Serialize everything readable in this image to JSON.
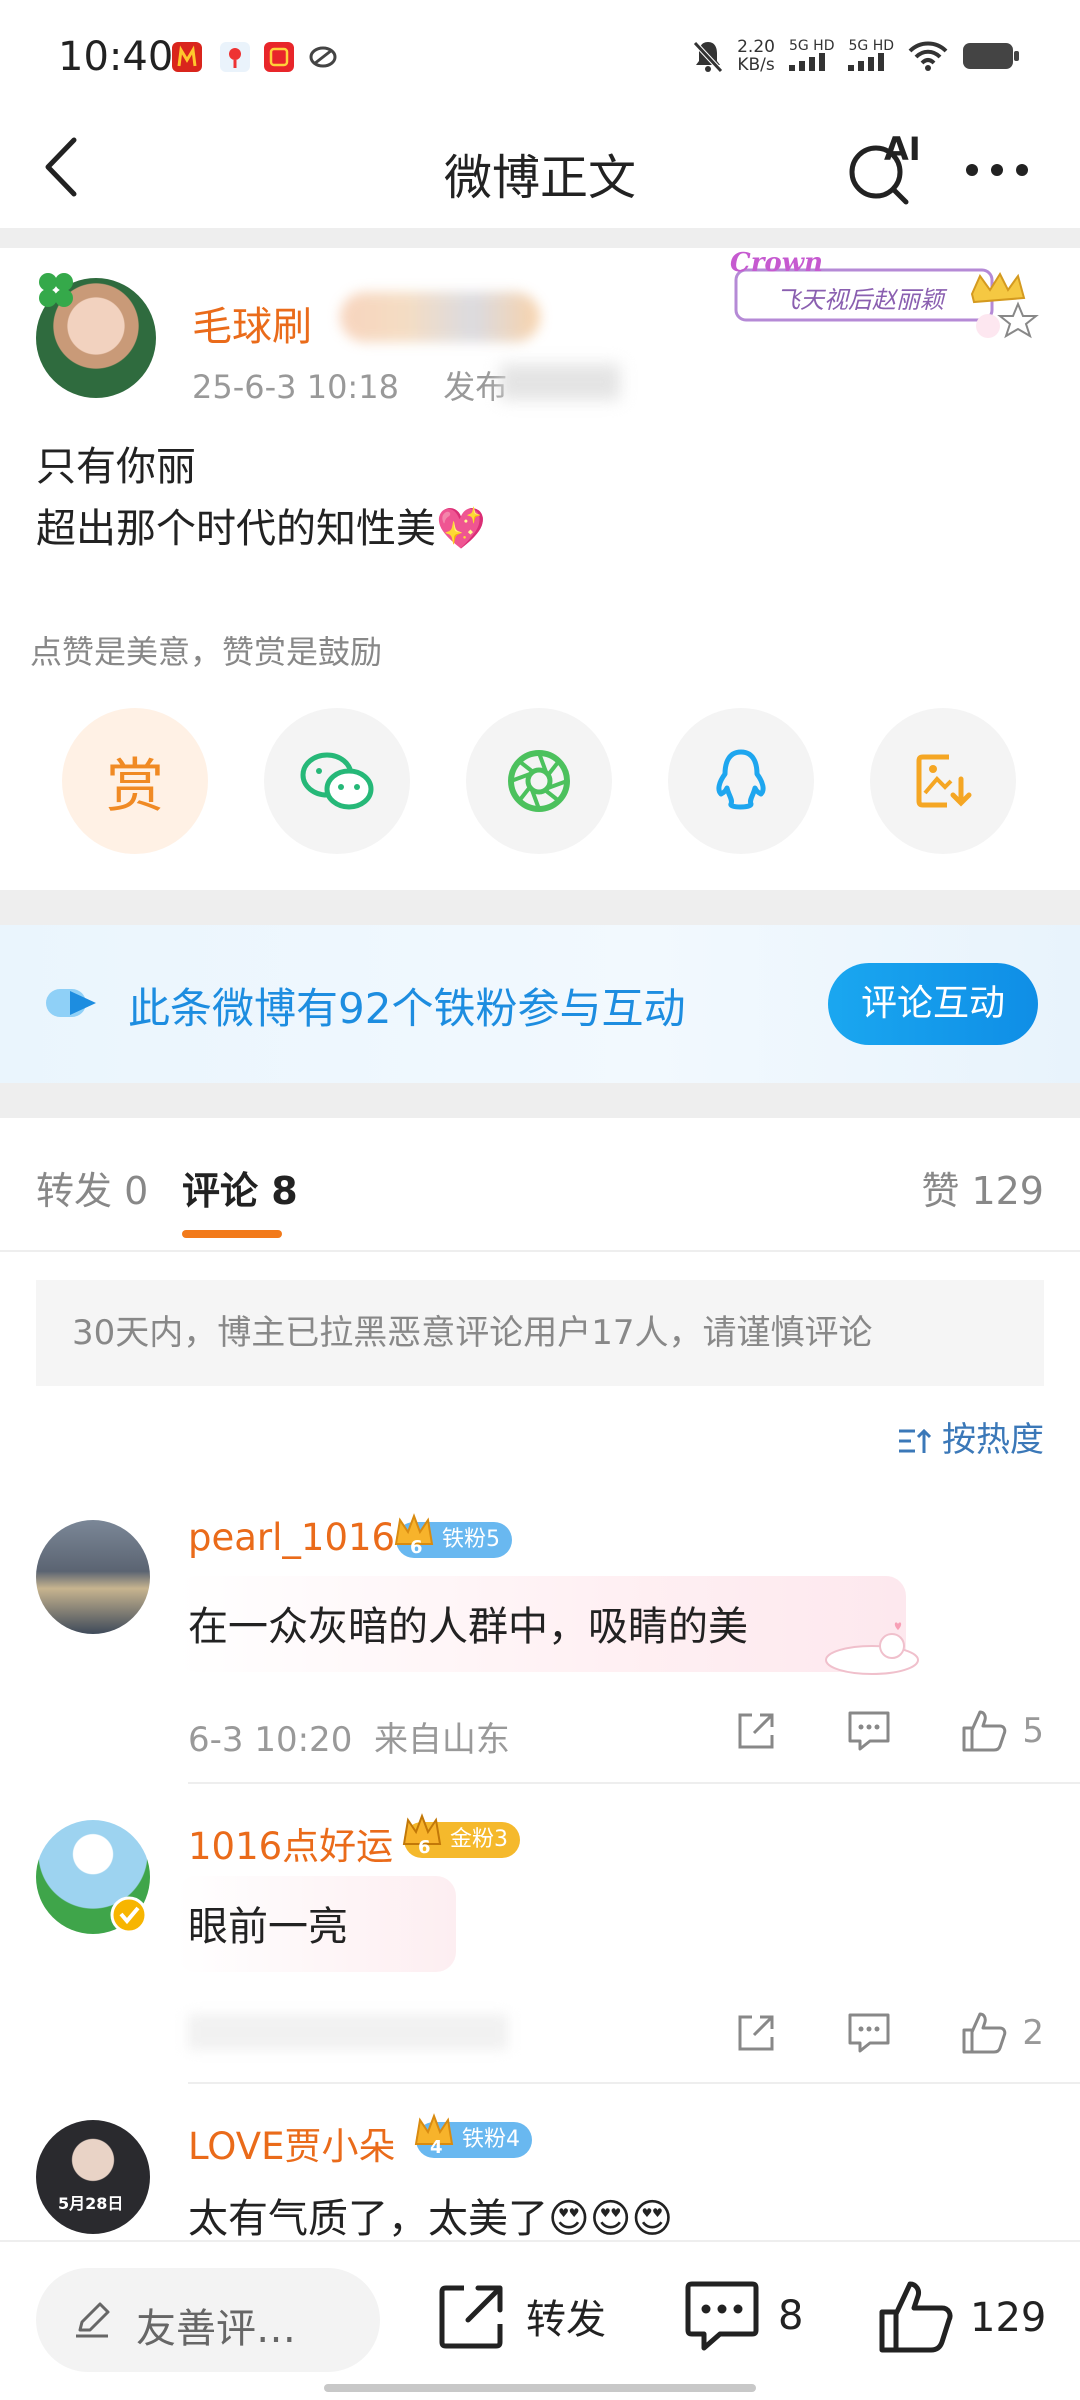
{
  "status_bar": {
    "time": "10:40",
    "net_speed_value": "2.20",
    "net_speed_unit": "KB/s",
    "sim1": "5G HD",
    "sim2": "5G HD"
  },
  "header": {
    "title": "微博正文",
    "ai_label": "AI"
  },
  "post": {
    "author_name": "毛球刷",
    "timestamp": "25-6-3 10:18",
    "publish_prefix": "发布",
    "crown_logo": "Crown",
    "crown_text": "飞天视后赵丽颖",
    "body_line1": "只有你丽",
    "body_line2": "超出那个时代的知性美💖",
    "reward_hint": "点赞是美意，赞赏是鼓励",
    "reward_label": "赏",
    "share_targets": [
      "reward-icon",
      "wechat-icon",
      "moments-icon",
      "qq-icon",
      "save-image-icon"
    ]
  },
  "fan_banner": {
    "text": "此条微博有92个铁粉参与互动",
    "button": "评论互动"
  },
  "tabs": {
    "repost": "转发 0",
    "comment": "评论 8",
    "likes": "赞 129"
  },
  "notice": "30天内，博主已拉黑恶意评论用户17人，请谨慎评论",
  "sort_label": "按热度",
  "comments": [
    {
      "name": "pearl_1016",
      "badge": "铁粉5",
      "badge_level": "6",
      "text": "在一众灰暗的人群中，吸睛的美",
      "meta": "6-3 10:20  来自山东",
      "likes": "5"
    },
    {
      "name": "1016点好运",
      "badge": "金粉3",
      "badge_level": "6",
      "text": "眼前一亮",
      "meta": "",
      "likes": "2"
    },
    {
      "name": "LOVE贾小朵",
      "badge": "铁粉4",
      "badge_level": "4",
      "text": "太有气质了，太美了😍😍😍",
      "avatar_caption": "5月28日"
    }
  ],
  "bottom_bar": {
    "comment_placeholder": "友善评…",
    "repost_label": "转发",
    "comment_count": "8",
    "like_count": "129"
  },
  "colors": {
    "brand_orange": "#ea6b1a",
    "link_blue": "#1d8de0",
    "tab_underline": "#f27a1a"
  }
}
